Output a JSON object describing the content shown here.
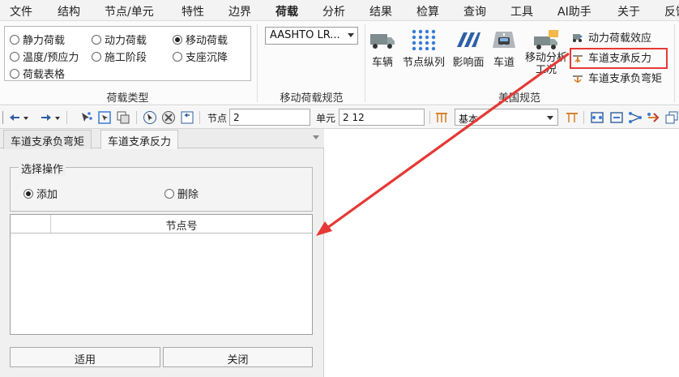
{
  "menubar": {
    "items": [
      "文件",
      "结构",
      "节点/单元",
      "特性",
      "边界",
      "荷载",
      "分析",
      "结果",
      "检算",
      "查询",
      "工具",
      "AI助手",
      "关于",
      "反馈"
    ],
    "active": "荷载"
  },
  "ribbon": {
    "load_types": {
      "group_label": "荷载类型",
      "options": [
        "静力荷载",
        "动力荷载",
        "移动荷载",
        "温度/预应力",
        "施工阶段",
        "支座沉降",
        "荷载表格"
      ],
      "selected": "移动荷载"
    },
    "moving_code": {
      "group_label": "移动荷载规范",
      "select_value": "AASHTO LR..."
    },
    "us_code": {
      "group_label": "美国规范",
      "buttons": [
        "车辆",
        "节点纵列",
        "影响面",
        "车道"
      ],
      "analysis_button_line1": "移动分析",
      "analysis_button_line2": "工况",
      "small_buttons": [
        "动力荷载效应",
        "车道支承反力",
        "车道支承负弯矩"
      ],
      "highlighted": "车道支承反力"
    }
  },
  "toolbar": {
    "node_label": "节点",
    "node_value": "2",
    "element_label": "单元",
    "element_value": "2 12",
    "basis_value": "基本"
  },
  "panel": {
    "tabs": [
      "车道支承负弯矩",
      "车道支承反力"
    ],
    "active_tab": "车道支承反力",
    "operation": {
      "legend": "选择操作",
      "options": [
        "添加",
        "删除"
      ],
      "selected": "添加"
    },
    "grid": {
      "columns": [
        "",
        "节点号"
      ],
      "rows": []
    },
    "buttons": {
      "apply": "适用",
      "close": "关闭"
    }
  },
  "colors": {
    "highlight": "#e53935",
    "arrow": "#e53935",
    "accent": "#3a6fb5"
  }
}
